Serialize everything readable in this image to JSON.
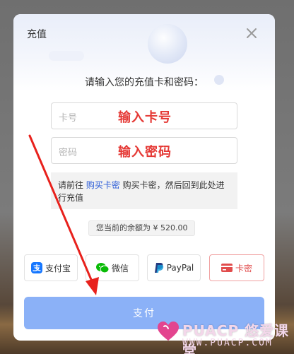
{
  "dialog": {
    "title": "充值",
    "prompt": "请输入您的充值卡和密码："
  },
  "card_field": {
    "placeholder": "卡号",
    "annotation": "输入卡号"
  },
  "password_field": {
    "placeholder": "密码",
    "annotation": "输入密码"
  },
  "notice": {
    "prefix": "请前往 ",
    "link": "购买卡密",
    "suffix": " 购买卡密，然后回到此处进行充值"
  },
  "balance": {
    "text": "您当前的余额为 ¥ 520.00"
  },
  "payment_methods": [
    {
      "label": "支付宝",
      "icon": "alipay-icon",
      "color": "#1677ff"
    },
    {
      "label": "微信",
      "icon": "wechat-icon",
      "color": "#09bb07"
    },
    {
      "label": "PayPal",
      "icon": "paypal-icon",
      "color": "#253b80"
    },
    {
      "label": "卡密",
      "icon": "card-icon",
      "color": "#e14c4c",
      "selected": true
    }
  ],
  "submit": {
    "label": "支付"
  },
  "watermark": {
    "brand": "PUACP 悠爱课堂",
    "url": "WWW.PUACP.COM"
  },
  "colors": {
    "accent": "#8bb1f7",
    "annotation_red": "#e53935",
    "link_blue": "#2a5bd7"
  }
}
